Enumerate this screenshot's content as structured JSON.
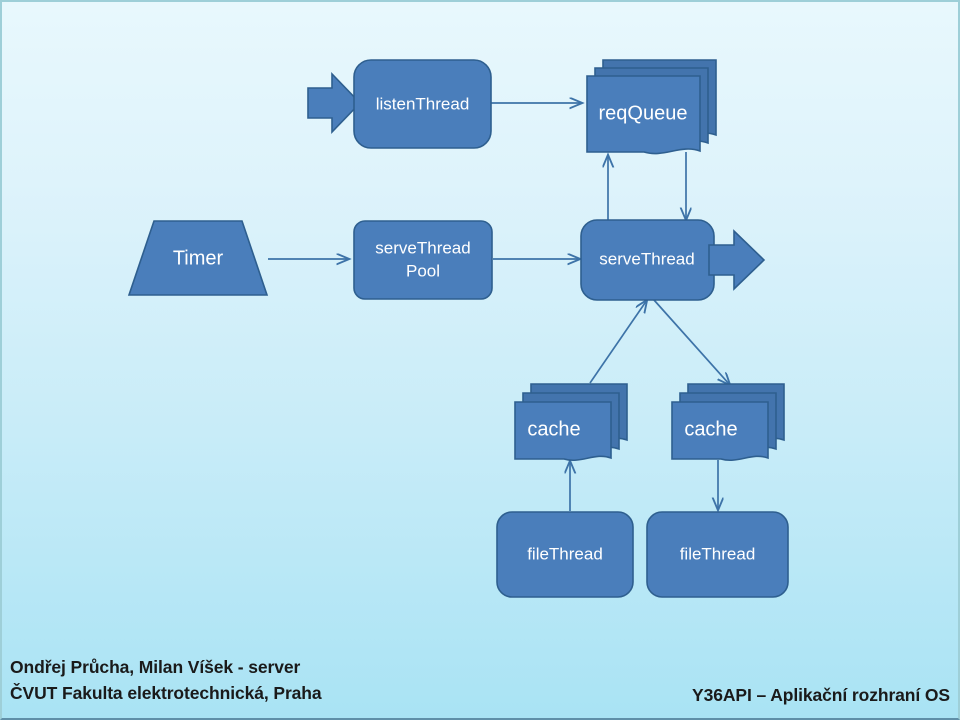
{
  "slide": {
    "background_top_color": "#e8f8fd",
    "background_bottom_color": "#a9e3f4",
    "shape_fill_color": "#4a7ebb",
    "shape_border_color": "#2e5f8f",
    "connector_color": "#3d73a8",
    "label_color": "#ffffff"
  },
  "diagram": {
    "nodes": {
      "inbound_arrow": {
        "label": "",
        "shape": "block-arrow-right"
      },
      "listen_thread": {
        "label": "listenThread",
        "shape": "rounded-rect"
      },
      "req_queue": {
        "label": "reqQueue",
        "shape": "stacked-document"
      },
      "timer": {
        "label": "Timer",
        "shape": "trapezoid"
      },
      "serve_thread_pool": {
        "label": "serveThread\nPool",
        "label_line1": "serveThread",
        "label_line2": "Pool",
        "shape": "rounded-rect"
      },
      "serve_thread": {
        "label": "serveThread",
        "shape": "rounded-rect"
      },
      "outbound_arrow": {
        "label": "",
        "shape": "block-arrow-right"
      },
      "cache_left": {
        "label": "cache",
        "shape": "stacked-document"
      },
      "cache_right": {
        "label": "cache",
        "shape": "stacked-document"
      },
      "file_thread_left": {
        "label": "fileThread",
        "shape": "rounded-rect"
      },
      "file_thread_right": {
        "label": "fileThread",
        "shape": "rounded-rect"
      }
    },
    "connectors": [
      {
        "from": "listen_thread",
        "to": "req_queue",
        "direction": "right"
      },
      {
        "from": "serve_thread",
        "to": "req_queue",
        "direction": "up"
      },
      {
        "from": "req_queue",
        "to": "serve_thread",
        "direction": "down"
      },
      {
        "from": "timer",
        "to": "serve_thread_pool",
        "direction": "right"
      },
      {
        "from": "serve_thread_pool",
        "to": "serve_thread",
        "direction": "right"
      },
      {
        "from": "cache_left",
        "to": "serve_thread",
        "direction": "up-right"
      },
      {
        "from": "serve_thread",
        "to": "cache_right",
        "direction": "down-right"
      },
      {
        "from": "file_thread_left",
        "to": "cache_left",
        "direction": "up"
      },
      {
        "from": "cache_right",
        "to": "file_thread_right",
        "direction": "down"
      }
    ]
  },
  "footer": {
    "authors_line1": "Ondřej Průcha, Milan Víšek - server",
    "authors_line2": "ČVUT Fakulta elektrotechnická, Praha",
    "course": "Y36API – Aplikační rozhraní  OS"
  }
}
